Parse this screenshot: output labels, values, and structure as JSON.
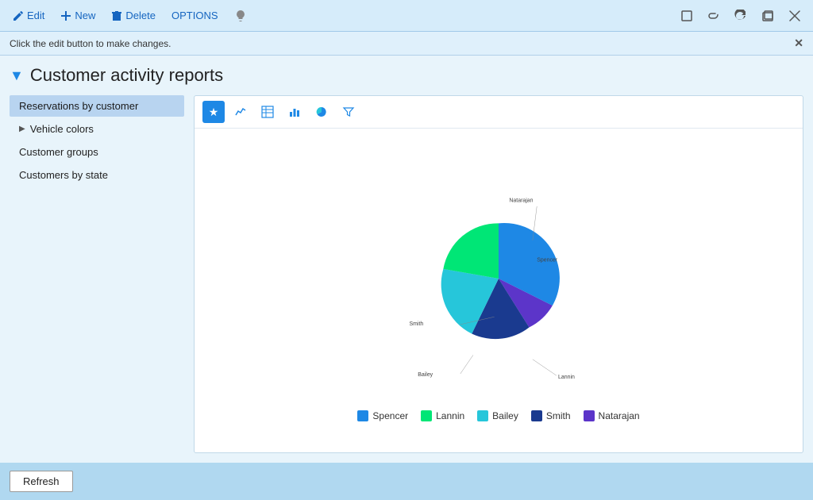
{
  "titlebar": {
    "edit_label": "Edit",
    "new_label": "New",
    "delete_label": "Delete",
    "options_label": "OPTIONS"
  },
  "infobar": {
    "message": "Click the edit button to make changes."
  },
  "page": {
    "title": "Customer activity reports"
  },
  "sidebar": {
    "items": [
      {
        "id": "reservations-by-customer",
        "label": "Reservations by customer",
        "active": true,
        "expandable": false
      },
      {
        "id": "vehicle-colors",
        "label": "Vehicle colors",
        "active": false,
        "expandable": true
      },
      {
        "id": "customer-groups",
        "label": "Customer groups",
        "active": false,
        "expandable": false
      },
      {
        "id": "customers-by-state",
        "label": "Customers by state",
        "active": false,
        "expandable": false
      }
    ]
  },
  "chart": {
    "segments": [
      {
        "name": "Spencer",
        "value": 28,
        "color": "#1e88e5",
        "startAngle": 0,
        "endAngle": 101
      },
      {
        "name": "Natarajan",
        "value": 8,
        "color": "#5c35c9",
        "startAngle": 101,
        "endAngle": 131
      },
      {
        "name": "Smith",
        "value": 12,
        "color": "#1a3a8f",
        "startAngle": 131,
        "endAngle": 175
      },
      {
        "name": "Bailey",
        "value": 25,
        "color": "#26c6da",
        "startAngle": 175,
        "endAngle": 265
      },
      {
        "name": "Lannin",
        "value": 18,
        "color": "#00e676",
        "startAngle": 265,
        "endAngle": 360
      }
    ]
  },
  "toolbar_icons": {
    "star": "★",
    "line": "📈",
    "table": "☰",
    "bar": "📊",
    "pie": "◕",
    "filter": "⊞"
  },
  "bottombar": {
    "refresh_label": "Refresh"
  }
}
